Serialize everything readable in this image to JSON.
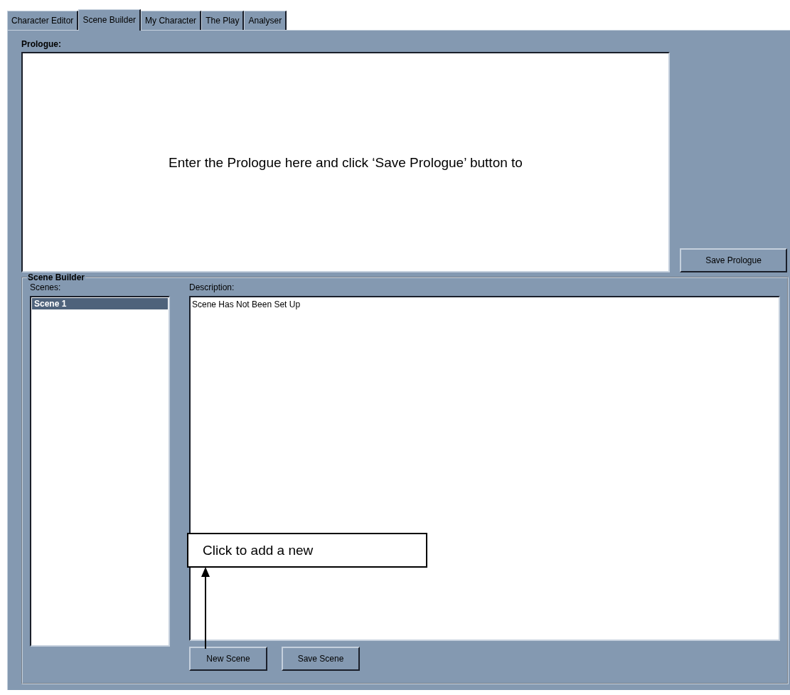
{
  "tabs": [
    {
      "label": "Character Editor",
      "selected": false
    },
    {
      "label": "Scene Builder",
      "selected": true
    },
    {
      "label": "My Character",
      "selected": false
    },
    {
      "label": "The Play",
      "selected": false
    },
    {
      "label": "Analyser",
      "selected": false
    }
  ],
  "prologue": {
    "label": "Prologue:",
    "annotation": "Enter the Prologue here and click ‘Save Prologue’ button to",
    "button": "Save Prologue"
  },
  "scene_builder": {
    "title": "Scene Builder",
    "scenes_label": "Scenes:",
    "scenes": [
      {
        "name": "Scene 1",
        "selected": true
      }
    ],
    "description_label": "Description:",
    "description": "Scene Has Not Been Set Up",
    "buttons": [
      "New Scene",
      "Save Scene"
    ],
    "callout": "Click to add a new"
  }
}
